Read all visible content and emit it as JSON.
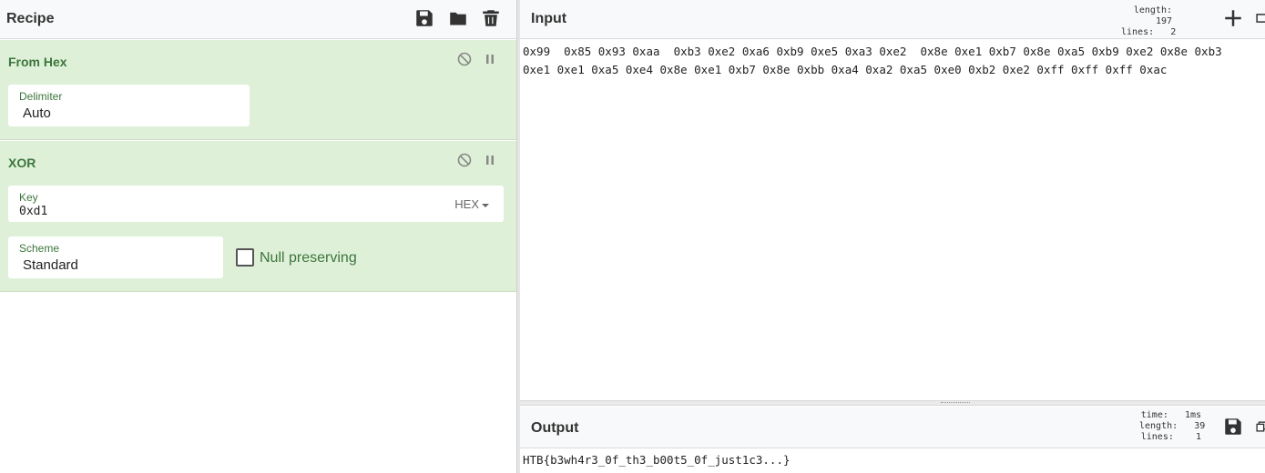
{
  "recipe": {
    "title": "Recipe",
    "icons": [
      "save-icon",
      "folder-icon",
      "trash-icon"
    ],
    "operations": [
      {
        "name": "From Hex",
        "fields": [
          {
            "label": "Delimiter",
            "value": "Auto"
          }
        ]
      },
      {
        "name": "XOR",
        "key": {
          "label": "Key",
          "value": "0xd1",
          "format": "HEX"
        },
        "scheme": {
          "label": "Scheme",
          "value": "Standard"
        },
        "null_preserving": {
          "label": "Null preserving",
          "checked": false
        }
      }
    ]
  },
  "input": {
    "title": "Input",
    "length_label": "length:",
    "length": "197",
    "lines_label": "lines:",
    "lines": "2",
    "line1": "0x99  0x85 0x93 0xaa  0xb3 0xe2 0xa6 0xb9 0xe5 0xa3 0xe2  0x8e 0xe1 0xb7 0x8e 0xa5 0xb9 0xe2 0x8e 0xb3",
    "line2": "0xe1 0xe1 0xa5 0xe4 0x8e 0xe1 0xb7 0x8e 0xbb 0xa4 0xa2 0xa5 0xe0 0xb2 0xe2 0xff 0xff 0xff 0xac"
  },
  "output": {
    "title": "Output",
    "time_label": "time:",
    "time": "1ms",
    "length_label": "length:",
    "length": "39",
    "lines_label": "lines:",
    "lines": "1",
    "text": "HTB{b3wh4r3_0f_th3_b00t5_0f_just1c3...}"
  },
  "colors": {
    "op_background": "#dff0d8",
    "op_title": "#3c763d"
  }
}
